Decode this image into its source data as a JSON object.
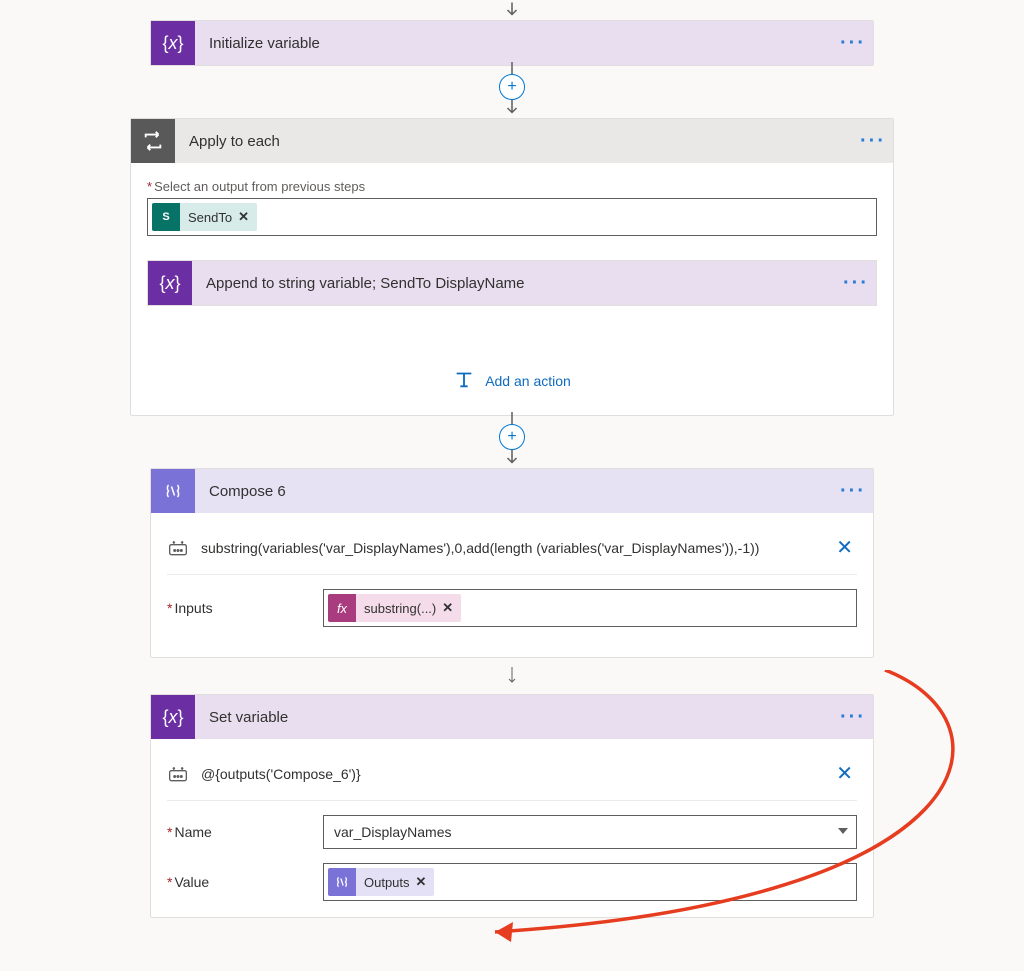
{
  "initVar": {
    "title": "Initialize variable"
  },
  "applyEach": {
    "title": "Apply to each",
    "selectLabel": "Select an output from previous steps",
    "chipLabel": "SendTo",
    "appendTitle": "Append to string variable; SendTo DisplayName",
    "addAction": "Add an action"
  },
  "compose6": {
    "title": "Compose 6",
    "peek": "substring(variables('var_DisplayNames'),0,add(length (variables('var_DisplayNames')),-1))",
    "inputsLabel": "Inputs",
    "chipLabel": "substring(...)"
  },
  "setVar": {
    "title": "Set variable",
    "peek": "@{outputs('Compose_6')}",
    "nameLabel": "Name",
    "nameValue": "var_DisplayNames",
    "valueLabel": "Value",
    "chipLabel": "Outputs"
  }
}
